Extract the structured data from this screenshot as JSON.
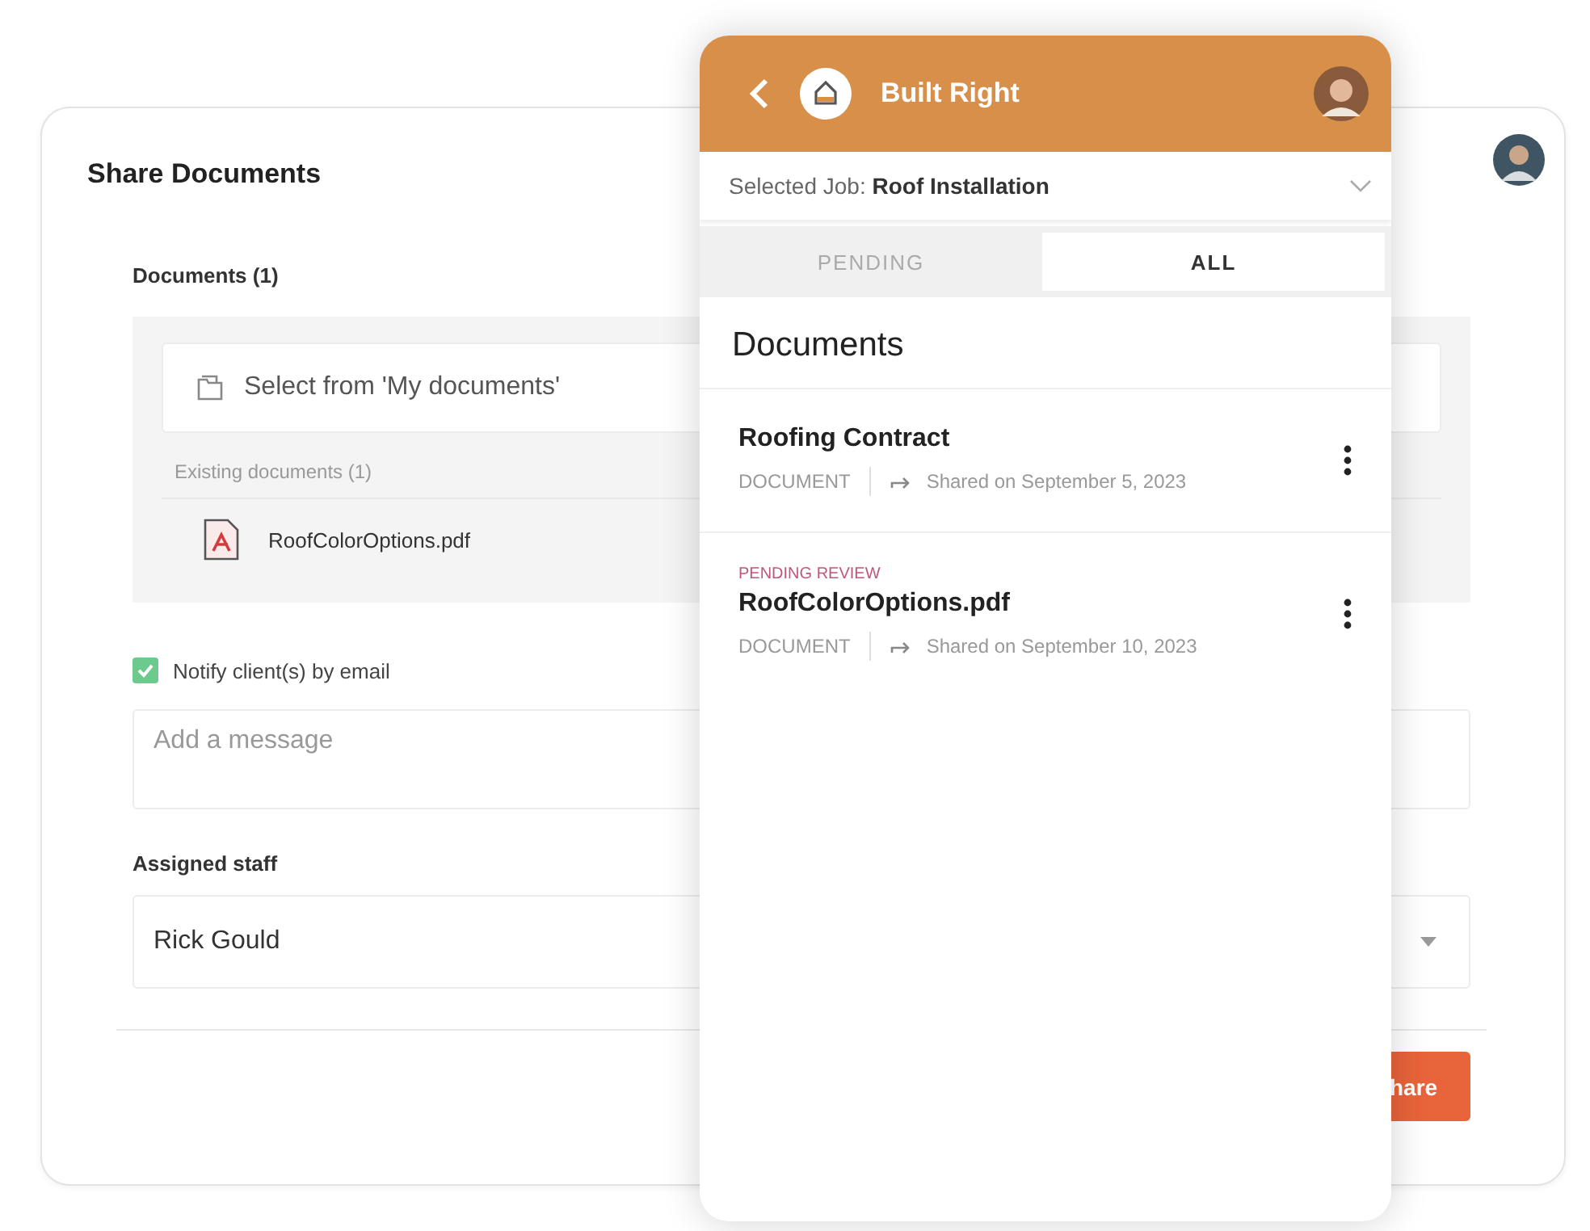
{
  "share_panel": {
    "title": "Share Documents",
    "documents_label": "Documents (1)",
    "picker": {
      "label": "Select from 'My documents'"
    },
    "existing_label": "Existing documents (1)",
    "files": [
      {
        "name": "RoofColorOptions.pdf"
      }
    ],
    "notify": {
      "label": "Notify client(s) by email",
      "checked": true
    },
    "message": {
      "placeholder": "Add a message"
    },
    "staff_label": "Assigned staff",
    "staff": {
      "value": "Rick Gould"
    },
    "share_button": "hare"
  },
  "phone": {
    "header": {
      "title": "Built Right"
    },
    "job": {
      "label": "Selected Job:",
      "value": "Roof Installation"
    },
    "tabs": [
      {
        "label": "PENDING",
        "selected": false
      },
      {
        "label": "ALL",
        "selected": true
      }
    ],
    "heading": "Documents",
    "documents": [
      {
        "name": "Roofing Contract",
        "type": "DOCUMENT",
        "shared": "Shared on September 5, 2023"
      },
      {
        "status": "PENDING REVIEW",
        "name": "RoofColorOptions.pdf",
        "type": "DOCUMENT",
        "shared": "Shared on September 10, 2023"
      }
    ]
  }
}
